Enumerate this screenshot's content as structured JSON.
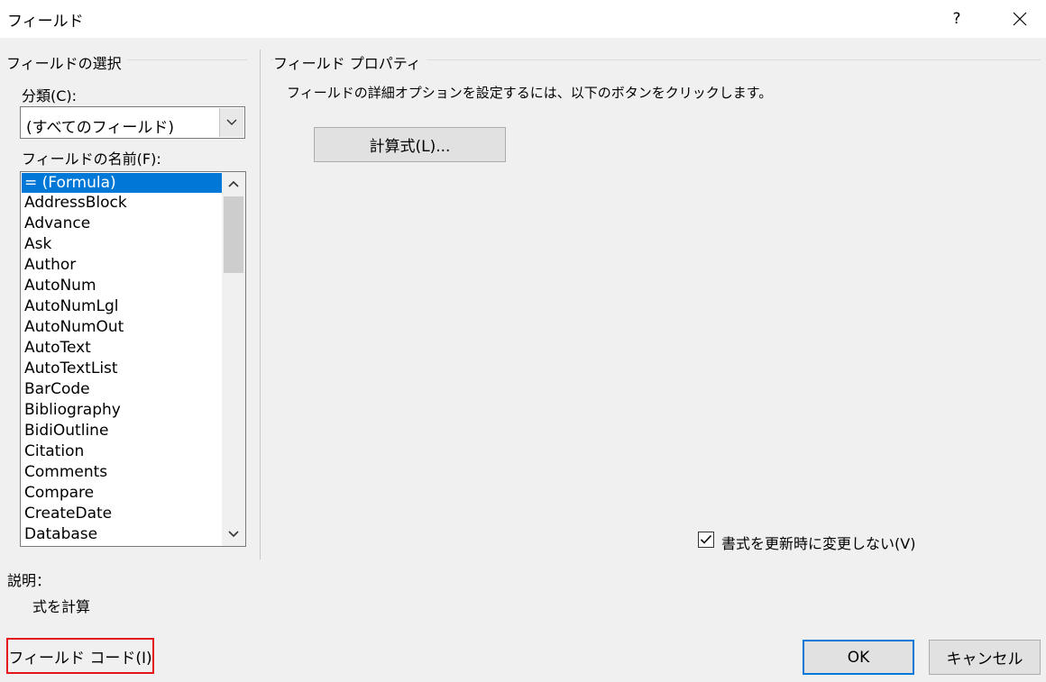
{
  "window": {
    "title": "フィールド",
    "help_label": "?",
    "close_icon": "close-icon"
  },
  "field_selection": {
    "group_title": "フィールドの選択",
    "category_label": "分類(C):",
    "category_value": "(すべてのフィールド)",
    "field_names_label": "フィールドの名前(F):",
    "field_names": [
      "= (Formula)",
      "AddressBlock",
      "Advance",
      "Ask",
      "Author",
      "AutoNum",
      "AutoNumLgl",
      "AutoNumOut",
      "AutoText",
      "AutoTextList",
      "BarCode",
      "Bibliography",
      "BidiOutline",
      "Citation",
      "Comments",
      "Compare",
      "CreateDate",
      "Database"
    ],
    "selected_index": 0
  },
  "field_properties": {
    "group_title": "フィールド プロパティ",
    "instruction": "フィールドの詳細オプションを設定するには、以下のボタンをクリックします。",
    "formula_button": "計算式(L)...",
    "preserve_format_label": "書式を更新時に変更しない(V)",
    "preserve_format_checked": true
  },
  "description": {
    "label": "説明：",
    "text": "式を計算"
  },
  "footer": {
    "field_codes_button": "フィールド コード(I)",
    "ok_button": "OK",
    "cancel_button": "キャンセル"
  },
  "colors": {
    "selection": "#0078d7",
    "highlight_border": "#e4141c"
  }
}
